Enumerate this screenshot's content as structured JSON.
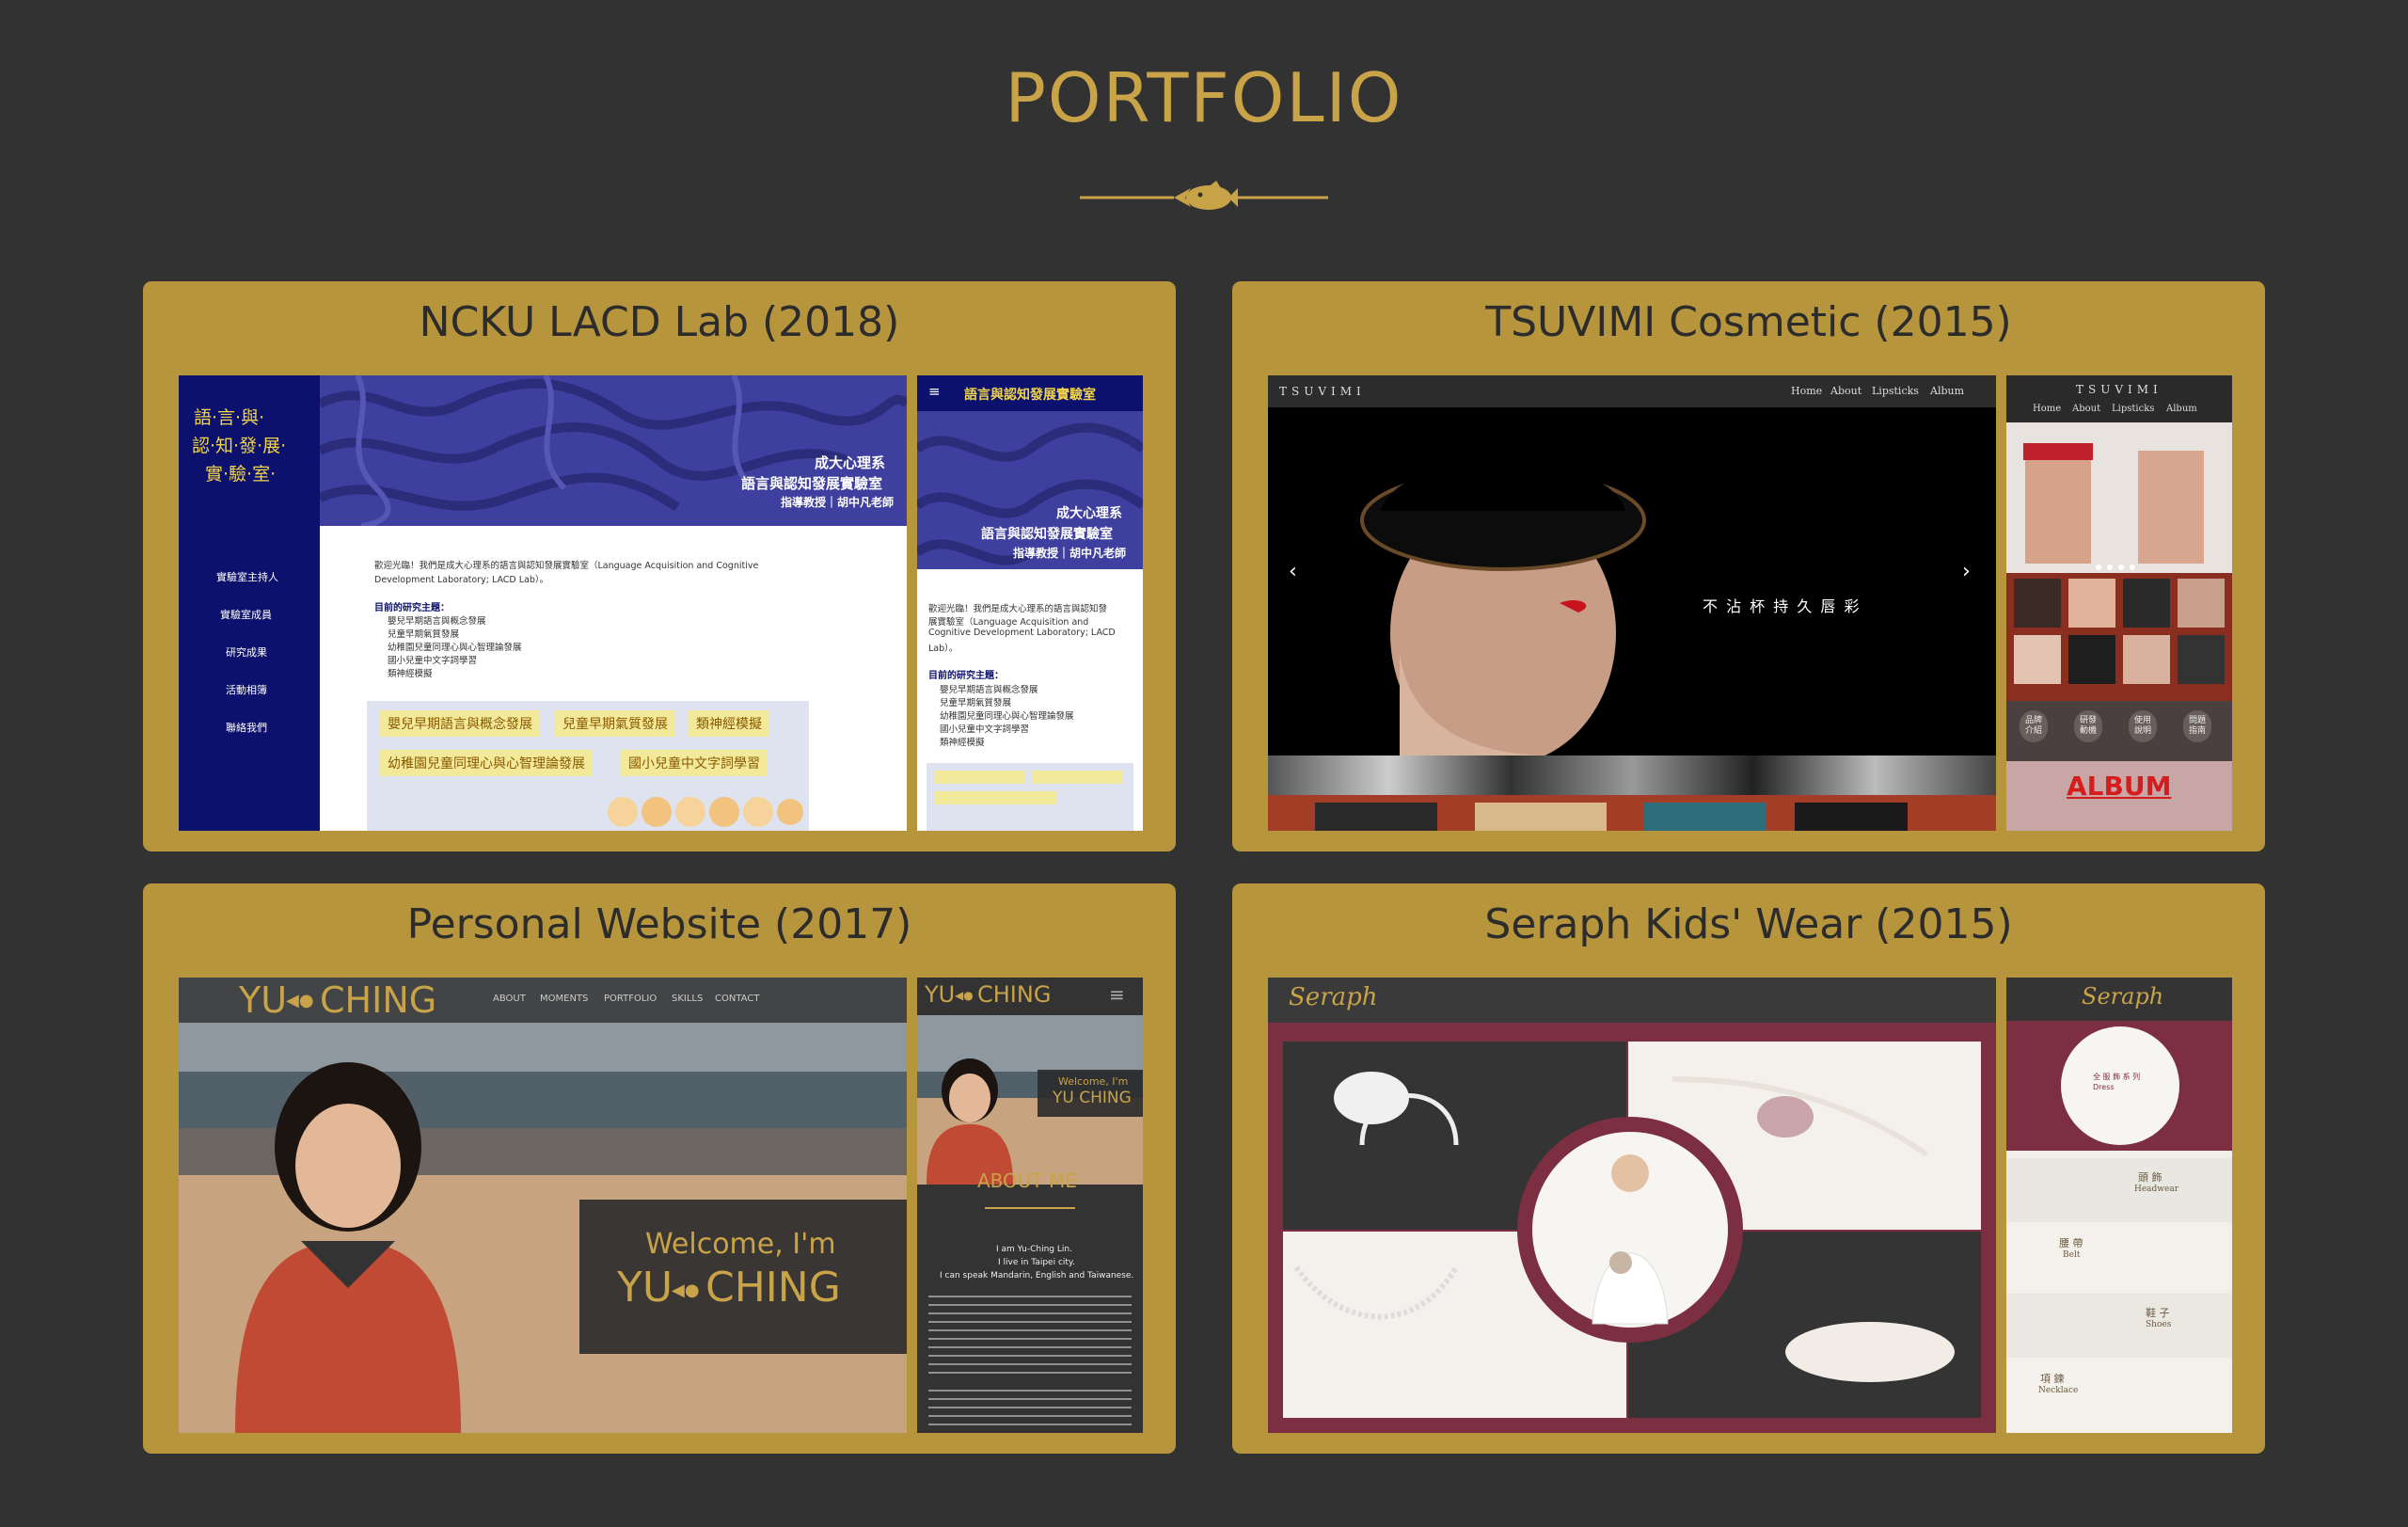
{
  "page": {
    "title": "PORTFOLIO"
  },
  "colors": {
    "background": "#323232",
    "accent": "#c9a348",
    "card": "#b7953d",
    "navy": "#0c116d"
  },
  "icons": {
    "divider": "fish-icon"
  },
  "cards": [
    {
      "title": "NCKU LACD Lab (2018)",
      "desktop": {
        "logo_line1": "語·言·與·",
        "logo_line2": "認·知·發·展·",
        "logo_line3": "實·驗·室·",
        "nav": [
          "實驗室主持人",
          "實驗室成員",
          "研究成果",
          "活動相簿",
          "聯絡我們"
        ],
        "hero_line1": "成大心理系",
        "hero_line2": "語言與認知發展實驗室",
        "hero_line3": "指導教授｜胡中凡老師",
        "intro": "歡迎光臨！我們是成大心理系的語言與認知發展實驗室（Language Acquisition and Cognitive",
        "intro2": "Development Laboratory; LACD Lab）。",
        "topics_label": "目前的研究主題：",
        "topics": [
          "嬰兒早期語言與概念發展",
          "兒童早期氣質發展",
          "幼稚園兒童同理心與心智理論發展",
          "國小兒童中文字詞學習",
          "類神經模擬"
        ],
        "tags_row1": [
          "嬰兒早期語言與概念發展",
          "兒童早期氣質發展",
          "類神經模擬"
        ],
        "tags_row2": [
          "幼稚園兒童同理心與心智理論發展",
          "國小兒童中文字詞學習"
        ]
      },
      "mobile": {
        "menu_icon": "≡",
        "header": "語言與認知發展實驗室",
        "hero_line1": "成大心理系",
        "hero_line2": "語言與認知發展實驗室",
        "hero_line3": "指導教授｜胡中凡老師",
        "intro": "歡迎光臨！我們是成大心理系的語言與認知發",
        "intro2": "展實驗室（Language Acquisition and",
        "intro3": "Cognitive Development Laboratory; LACD",
        "intro4": "Lab）。",
        "topics_label": "目前的研究主題：",
        "topics": [
          "嬰兒早期語言與概念發展",
          "兒童早期氣質發展",
          "幼稚園兒童同理心與心智理論發展",
          "國小兒童中文字詞學習",
          "類神經模擬"
        ]
      }
    },
    {
      "title": "TSUVIMI Cosmetic (2015)",
      "desktop": {
        "brand": "TSUVIMI",
        "nav": [
          "Home",
          "About",
          "Lipsticks",
          "Album"
        ],
        "tagline": "不 沾 杯 持 久 唇 彩"
      },
      "mobile": {
        "brand": "TSUVIMI",
        "nav": [
          "Home",
          "About",
          "Lipsticks",
          "Album"
        ],
        "buttons": [
          "品牌\n介紹",
          "研發\n動機",
          "使用\n說明",
          "問題\n指南"
        ],
        "album": "ALBUM"
      }
    },
    {
      "title": "Personal Website (2017)",
      "desktop": {
        "logo_left": "YU",
        "logo_right": "CHING",
        "nav": [
          "ABOUT",
          "MOMENTS",
          "PORTFOLIO",
          "SKILLS",
          "CONTACT"
        ],
        "welcome": "Welcome, I'm",
        "name_left": "YU",
        "name_right": "CHING"
      },
      "mobile": {
        "logo_left": "YU",
        "logo_right": "CHING",
        "menu_icon": "≡",
        "welcome": "Welcome, I'm",
        "name": "YU CHING",
        "about": "ABOUT ME",
        "bio1": "I am Yu-Ching Lin.",
        "bio2": "I live in Taipei city.",
        "bio3": "I can speak Mandarin, English and Taiwanese."
      }
    },
    {
      "title": "Seraph Kids' Wear (2015)",
      "desktop": {
        "brand": "Seraph"
      },
      "mobile": {
        "brand": "Seraph",
        "medallion": "全 服 飾 系 列 Dress",
        "categories": [
          {
            "zh": "頭 飾",
            "en": "Headwear"
          },
          {
            "zh": "腰 帶",
            "en": "Belt"
          },
          {
            "zh": "鞋 子",
            "en": "Shoes"
          },
          {
            "zh": "項 鍊",
            "en": "Necklace"
          }
        ]
      }
    }
  ]
}
